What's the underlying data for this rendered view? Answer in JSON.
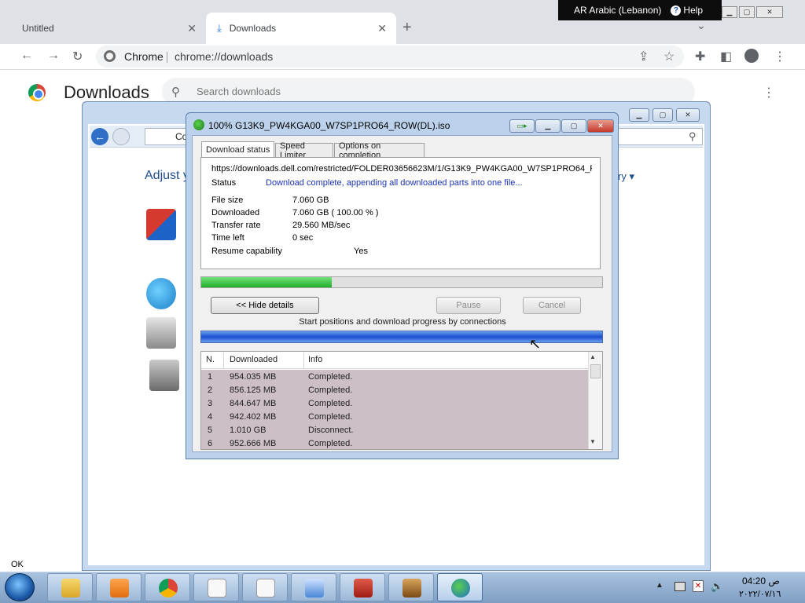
{
  "browser": {
    "tabs": [
      {
        "label": "Untitled"
      },
      {
        "label": "Downloads"
      }
    ],
    "omnibox_chrome": "Chrome",
    "omnibox_url": "chrome://downloads"
  },
  "downloads_page": {
    "title": "Downloads",
    "search_placeholder": "Search downloads"
  },
  "langbar": {
    "language": "AR Arabic (Lebanon)",
    "help": "Help"
  },
  "explorer": {
    "address": "Co",
    "heading": "Adjust y",
    "category": "ry"
  },
  "idm": {
    "title": "100% G13K9_PW4KGA00_W7SP1PRO64_ROW(DL).iso",
    "tabs": [
      "Download status",
      "Speed Limiter",
      "Options on completion"
    ],
    "url": "https://downloads.dell.com/restricted/FOLDER03656623M/1/G13K9_PW4KGA00_W7SP1PRO64_ROW",
    "status_label": "Status",
    "status_value": "Download complete, appending all downloaded parts into one file...",
    "file_size_label": "File size",
    "file_size_value": "7.060  GB",
    "downloaded_label": "Downloaded",
    "downloaded_value": "7.060  GB  ( 100.00 % )",
    "transfer_rate_label": "Transfer rate",
    "transfer_rate_value": "29.560  MB/sec",
    "time_left_label": "Time left",
    "time_left_value": "0 sec",
    "resume_label": "Resume capability",
    "resume_value": "Yes",
    "progress_fraction": 0.325,
    "hide_details_label": "<< Hide details",
    "pause_label": "Pause",
    "cancel_label": "Cancel",
    "connections_label": "Start positions and download progress by connections",
    "table": {
      "columns": [
        "N.",
        "Downloaded",
        "Info"
      ],
      "rows": [
        [
          "1",
          "954.035  MB",
          "Completed."
        ],
        [
          "2",
          "856.125  MB",
          "Completed."
        ],
        [
          "3",
          "844.647  MB",
          "Completed."
        ],
        [
          "4",
          "942.402  MB",
          "Completed."
        ],
        [
          "5",
          "1.010  GB",
          "Disconnect."
        ],
        [
          "6",
          "952.666  MB",
          "Completed."
        ]
      ]
    }
  },
  "taskbar": {
    "time": "04:20 ص",
    "date": "٢٠٢٢/٠٧/١٦"
  },
  "stray": {
    "ok": "OK"
  },
  "colors": {
    "accent_blue": "#1a73e8",
    "progress_green": "#1fae2b",
    "status_blue": "#1a33b5"
  }
}
